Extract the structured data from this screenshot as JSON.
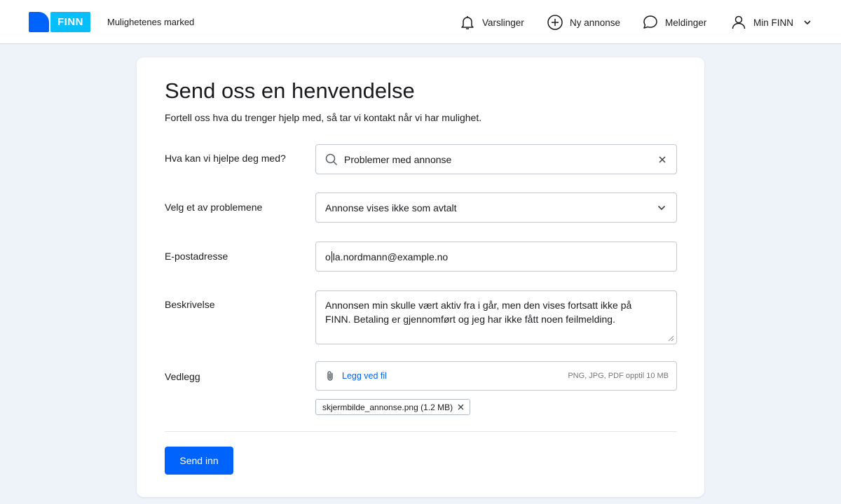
{
  "header": {
    "logo_text": "FINN",
    "tagline": "Mulighetenes marked",
    "nav": {
      "alerts": "Varslinger",
      "new_ad": "Ny annonse",
      "messages": "Meldinger",
      "account": "Min FINN"
    },
    "icons": [
      "bell-icon",
      "plus-circle-icon",
      "chat-bubble-icon",
      "user-icon",
      "chevron-down-icon"
    ]
  },
  "form": {
    "title": "Send oss en henvendelse",
    "subtitle": "Fortell oss hva du trenger hjelp med, så tar vi kontakt når vi har mulighet.",
    "help_topic": {
      "label": "Hva kan vi hjelpe deg med?",
      "value": "Problemer med annonse"
    },
    "problem": {
      "label": "Velg et av problemene",
      "value": "Annonse vises ikke som avtalt"
    },
    "email": {
      "label": "E-postadresse",
      "value_before_caret": "o",
      "value_after_caret": "la.nordmann@example.no"
    },
    "description": {
      "label": "Beskrivelse",
      "value": "Annonsen min skulle vært aktiv fra i går, men den vises fortsatt ikke på FINN. Betaling er gjennomført og jeg har ikke fått noen feilmelding."
    },
    "attachment": {
      "label": "Vedlegg",
      "link": "Legg ved fil",
      "hint": "PNG, JPG, PDF opptil 10 MB",
      "file_chip": "skjermbilde_annonse.png (1.2 MB)"
    },
    "submit_label": "Send inn"
  },
  "colors": {
    "brand_blue": "#0063fb",
    "brand_cyan": "#06befb",
    "page_bg": "#eef2f9"
  }
}
